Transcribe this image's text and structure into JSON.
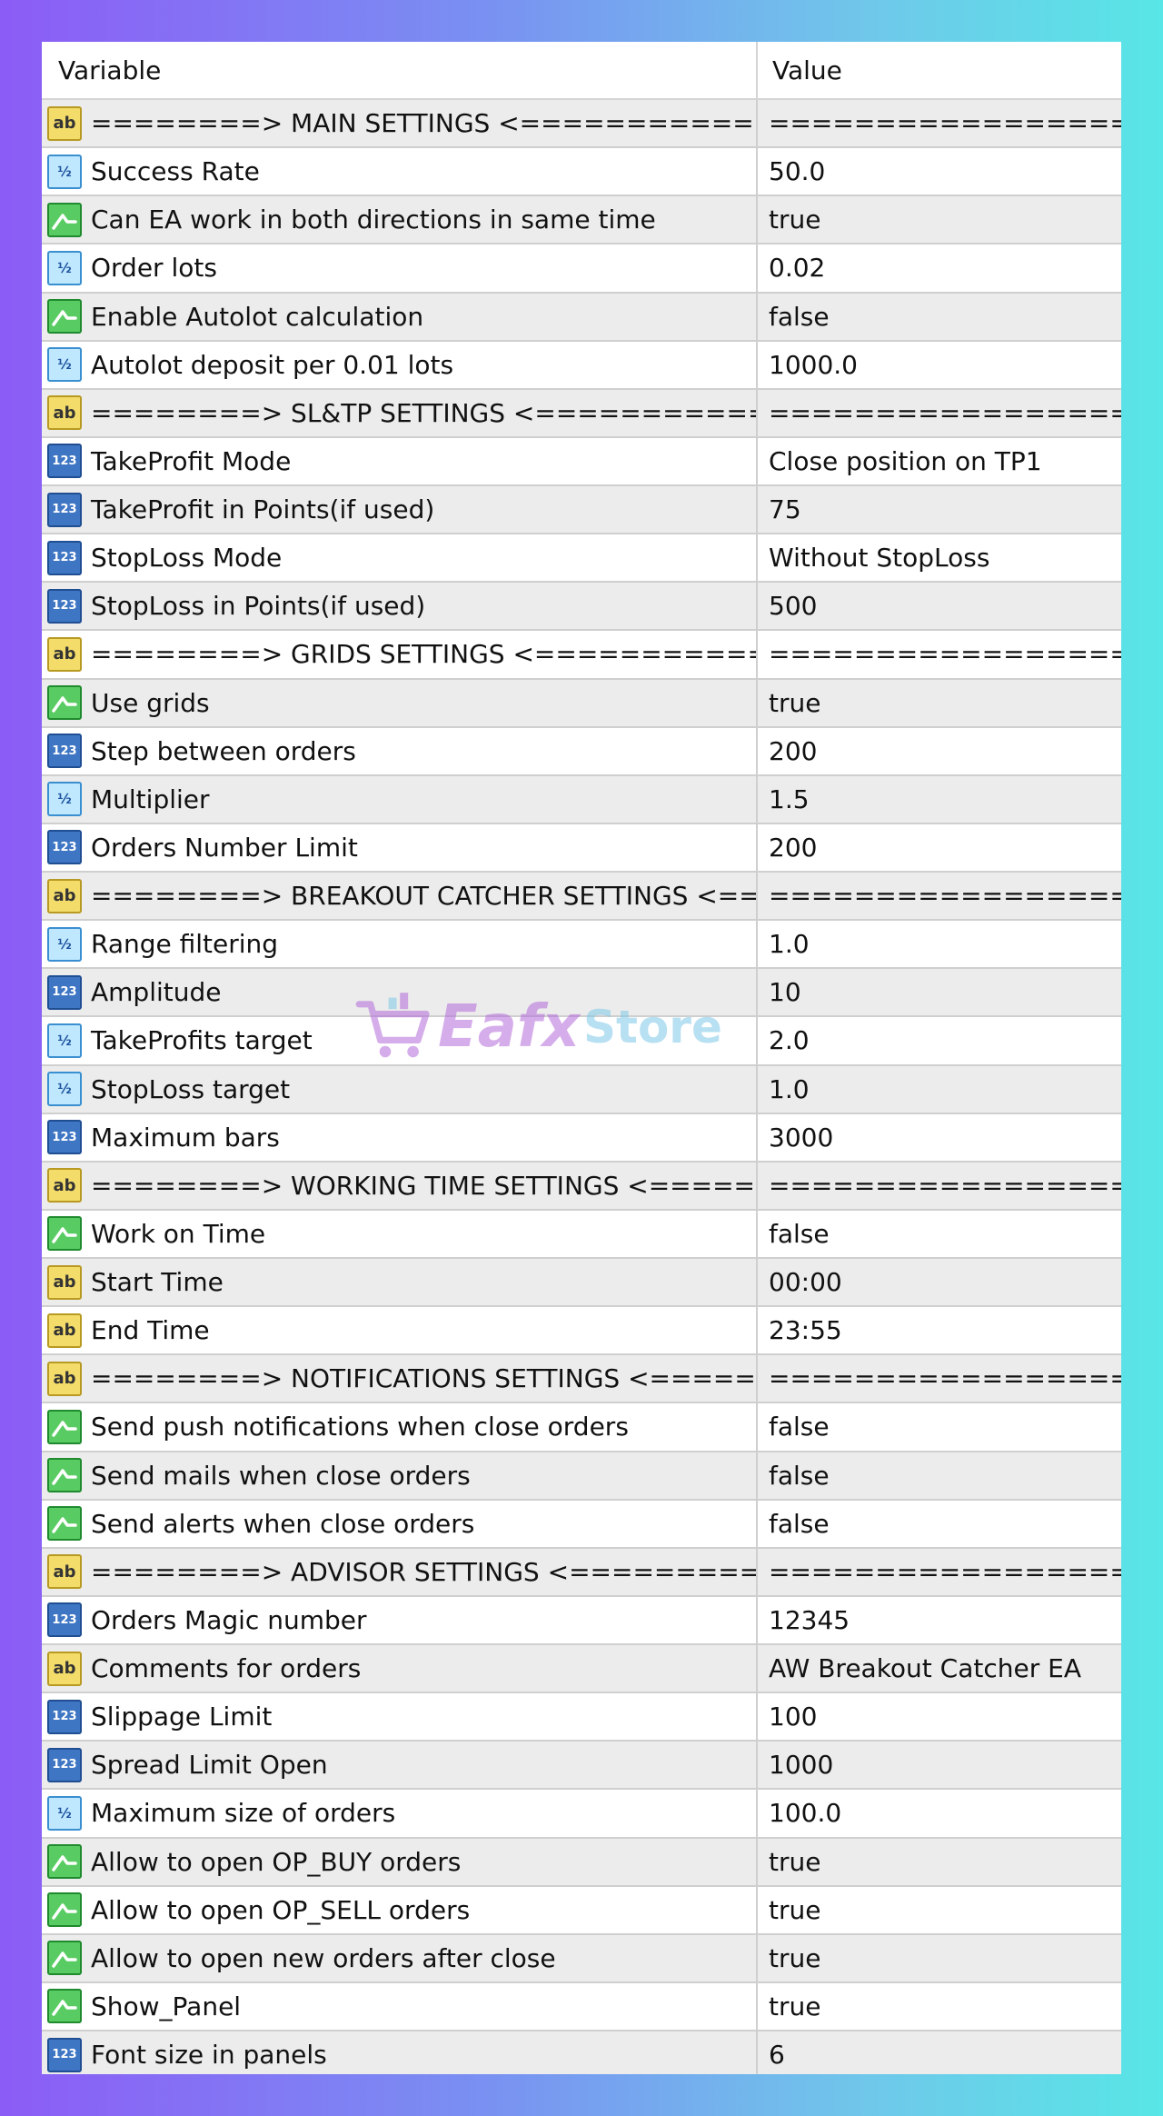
{
  "header": {
    "variable": "Variable",
    "value": "Value"
  },
  "watermark": {
    "part1": "Eafx",
    "part2": "Store"
  },
  "rows": [
    {
      "type": "ab",
      "name": "========> MAIN SETTINGS  <==================...",
      "value": "=============================="
    },
    {
      "type": "half",
      "name": "Success Rate",
      "value": "50.0"
    },
    {
      "type": "bool",
      "name": "Can EA work in both directions in same time",
      "value": "true"
    },
    {
      "type": "half",
      "name": "Order lots",
      "value": "0.02"
    },
    {
      "type": "bool",
      "name": "Enable Autolot  calculation",
      "value": "false"
    },
    {
      "type": "half",
      "name": "Autolot deposit per 0.01 lots",
      "value": "1000.0"
    },
    {
      "type": "ab",
      "name": "========> SL&TP SETTINGS  <=================...",
      "value": "=============================="
    },
    {
      "type": "n123",
      "name": "TakeProfit Mode",
      "value": "Close position on TP1"
    },
    {
      "type": "n123",
      "name": "TakeProfit in Points(if used)",
      "value": "75"
    },
    {
      "type": "n123",
      "name": "StopLoss Mode",
      "value": "Without StopLoss"
    },
    {
      "type": "n123",
      "name": "StopLoss in Points(if used)",
      "value": "500"
    },
    {
      "type": "ab",
      "name": "========> GRIDS SETTINGS  <=================...",
      "value": "=============================="
    },
    {
      "type": "bool",
      "name": "Use grids",
      "value": "true"
    },
    {
      "type": "n123",
      "name": "Step between orders",
      "value": "200"
    },
    {
      "type": "half",
      "name": "Multiplier",
      "value": "1.5"
    },
    {
      "type": "n123",
      "name": "Orders Number Limit",
      "value": "200"
    },
    {
      "type": "ab",
      "name": "========> BREAKOUT CATCHER SETTINGS  <====...",
      "value": "=============================="
    },
    {
      "type": "half",
      "name": "Range filtering",
      "value": "1.0"
    },
    {
      "type": "n123",
      "name": "Amplitude",
      "value": "10"
    },
    {
      "type": "half",
      "name": "TakeProfits target",
      "value": "2.0"
    },
    {
      "type": "half",
      "name": "StopLoss target",
      "value": "1.0"
    },
    {
      "type": "n123",
      "name": "Maximum bars",
      "value": "3000"
    },
    {
      "type": "ab",
      "name": "========> WORKING TIME SETTINGS  <=========...",
      "value": "=============================="
    },
    {
      "type": "bool",
      "name": "Work on Time",
      "value": "false"
    },
    {
      "type": "ab",
      "name": "Start Time",
      "value": "00:00"
    },
    {
      "type": "ab",
      "name": "End Time",
      "value": "23:55"
    },
    {
      "type": "ab",
      "name": "========> NOTIFICATIONS SETTINGS  <=========...",
      "value": "=============================="
    },
    {
      "type": "bool",
      "name": "Send push notifications when close orders",
      "value": "false"
    },
    {
      "type": "bool",
      "name": "Send mails when close orders",
      "value": "false"
    },
    {
      "type": "bool",
      "name": "Send alerts when close orders",
      "value": "false"
    },
    {
      "type": "ab",
      "name": "========> ADVISOR SETTINGS  <==============...",
      "value": "=============================="
    },
    {
      "type": "n123",
      "name": "Orders Magic number",
      "value": "12345"
    },
    {
      "type": "ab",
      "name": "Comments for orders",
      "value": "AW Breakout Catcher EA"
    },
    {
      "type": "n123",
      "name": "Slippage Limit",
      "value": "100"
    },
    {
      "type": "n123",
      "name": "Spread Limit Open",
      "value": "1000"
    },
    {
      "type": "half",
      "name": "Maximum size of orders",
      "value": "100.0"
    },
    {
      "type": "bool",
      "name": "Allow to open OP_BUY orders",
      "value": "true"
    },
    {
      "type": "bool",
      "name": "Allow to open OP_SELL orders",
      "value": "true"
    },
    {
      "type": "bool",
      "name": "Allow to open new orders after close",
      "value": "true"
    },
    {
      "type": "bool",
      "name": "Show_Panel",
      "value": "true"
    },
    {
      "type": "n123",
      "name": "Font size in panels",
      "value": "6"
    }
  ],
  "icons": {
    "ab": {
      "name": "string-type-icon",
      "glyph": "ab"
    },
    "half": {
      "name": "double-type-icon",
      "glyph": "½"
    },
    "n123": {
      "name": "integer-type-icon",
      "glyph": "123"
    },
    "bool": {
      "name": "bool-type-icon",
      "glyph": ""
    }
  }
}
